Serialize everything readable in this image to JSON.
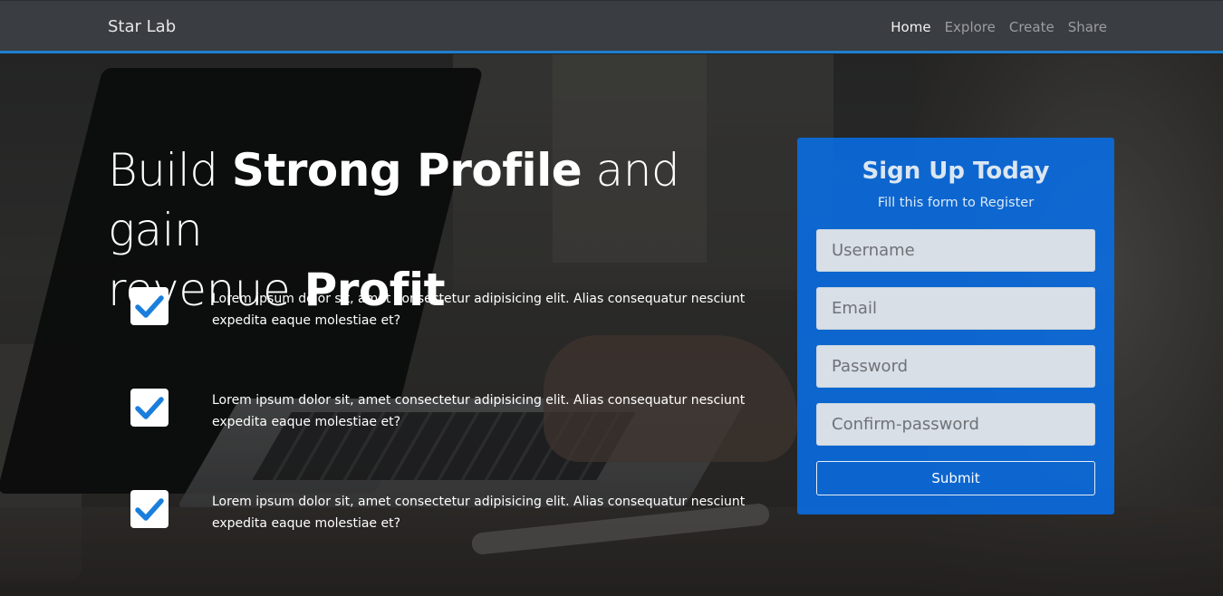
{
  "navbar": {
    "brand": "Star Lab",
    "links": [
      {
        "label": "Home",
        "active": true
      },
      {
        "label": "Explore",
        "active": false
      },
      {
        "label": "Create",
        "active": false
      },
      {
        "label": "Share",
        "active": false
      }
    ],
    "accent_color": "#1e7fd0"
  },
  "hero": {
    "title_line1_part1": "Build ",
    "title_line1_strong": "Strong Profile",
    "title_line1_part2": " and gain",
    "title_line2_part1": "revenue ",
    "title_line2_strong": "Profit"
  },
  "features": [
    {
      "icon": "check-icon",
      "text": "Lorem ipsum dolor sit, amet consectetur adipisicing elit. Alias consequatur nesciunt expedita eaque molestiae et?"
    },
    {
      "icon": "check-icon",
      "text": "Lorem ipsum dolor sit, amet consectetur adipisicing elit. Alias consequatur nesciunt expedita eaque molestiae et?"
    },
    {
      "icon": "check-icon",
      "text": "Lorem ipsum dolor sit, amet consectetur adipisicing elit. Alias consequatur nesciunt expedita eaque molestiae et?"
    }
  ],
  "signup": {
    "title": "Sign Up Today",
    "subtitle": "Fill this form to Register",
    "username_placeholder": "Username",
    "email_placeholder": "Email",
    "password_placeholder": "Password",
    "confirm_placeholder": "Confirm-password",
    "submit_label": "Submit",
    "card_color": "#096ee6"
  }
}
